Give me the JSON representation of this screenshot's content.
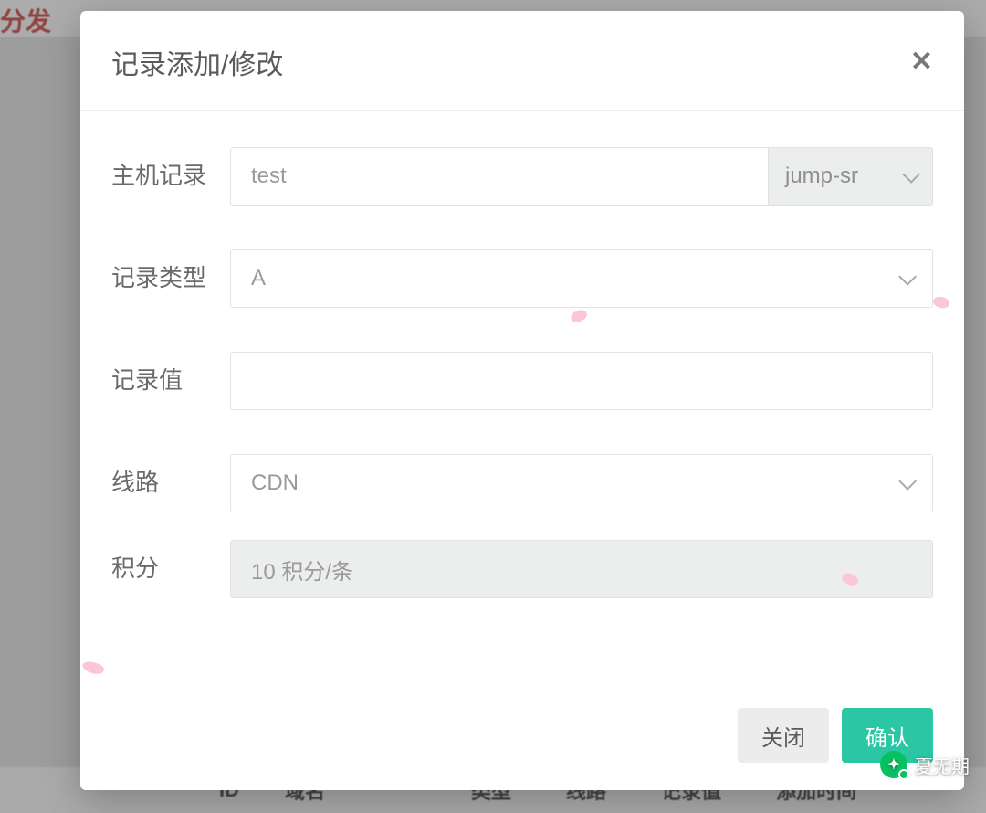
{
  "background": {
    "page_title": "分发",
    "table_headers": [
      "ID",
      "域名",
      "类型",
      "线路",
      "记录值",
      "添加时间"
    ]
  },
  "modal": {
    "title": "记录添加/修改",
    "form": {
      "host_record": {
        "label": "主机记录",
        "value": "test",
        "suffix_selected": "jump-sr"
      },
      "record_type": {
        "label": "记录类型",
        "value": "A"
      },
      "record_value": {
        "label": "记录值",
        "value": ""
      },
      "line": {
        "label": "线路",
        "value": "CDN"
      },
      "points": {
        "label": "积分",
        "value": "10 积分/条"
      }
    },
    "footer": {
      "cancel": "关闭",
      "confirm": "确认"
    }
  },
  "watermark": {
    "text": "夏无期"
  }
}
